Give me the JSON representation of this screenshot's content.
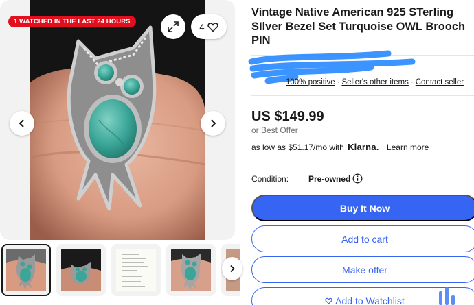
{
  "gallery": {
    "badge": "1 WATCHED IN THE LAST 24 HOURS",
    "watch_count": "4",
    "colors": {
      "badge": "#e0101e",
      "turquoise": "#3aa698",
      "silver": "#a8a8a8"
    },
    "icons": [
      "expand-icon",
      "heart-icon",
      "chevron-left-icon",
      "chevron-right-icon"
    ],
    "thumbnails": [
      {
        "label": ""
      },
      {
        "label": ""
      },
      {
        "label": ""
      },
      {
        "label": ""
      },
      {
        "label": ""
      }
    ]
  },
  "listing": {
    "title": "Vintage Native American 925 STerling SIlver Bezel Set Turquoise OWL Brooch PIN",
    "seller_links": {
      "positive": "100% positive",
      "other_items": "Seller's other items",
      "contact": "Contact seller"
    },
    "price": "US $149.99",
    "best_offer": "or Best Offer",
    "klarna": {
      "prefix": "as low as $51.17/mo with",
      "brand": "Klarna.",
      "learn_more": "Learn more"
    },
    "condition": {
      "label": "Condition:",
      "value": "Pre-owned"
    },
    "buttons": {
      "buy": "Buy It Now",
      "cart": "Add to cart",
      "offer": "Make offer",
      "watch": "Add to Watchlist"
    },
    "accent": "#3665f3"
  }
}
